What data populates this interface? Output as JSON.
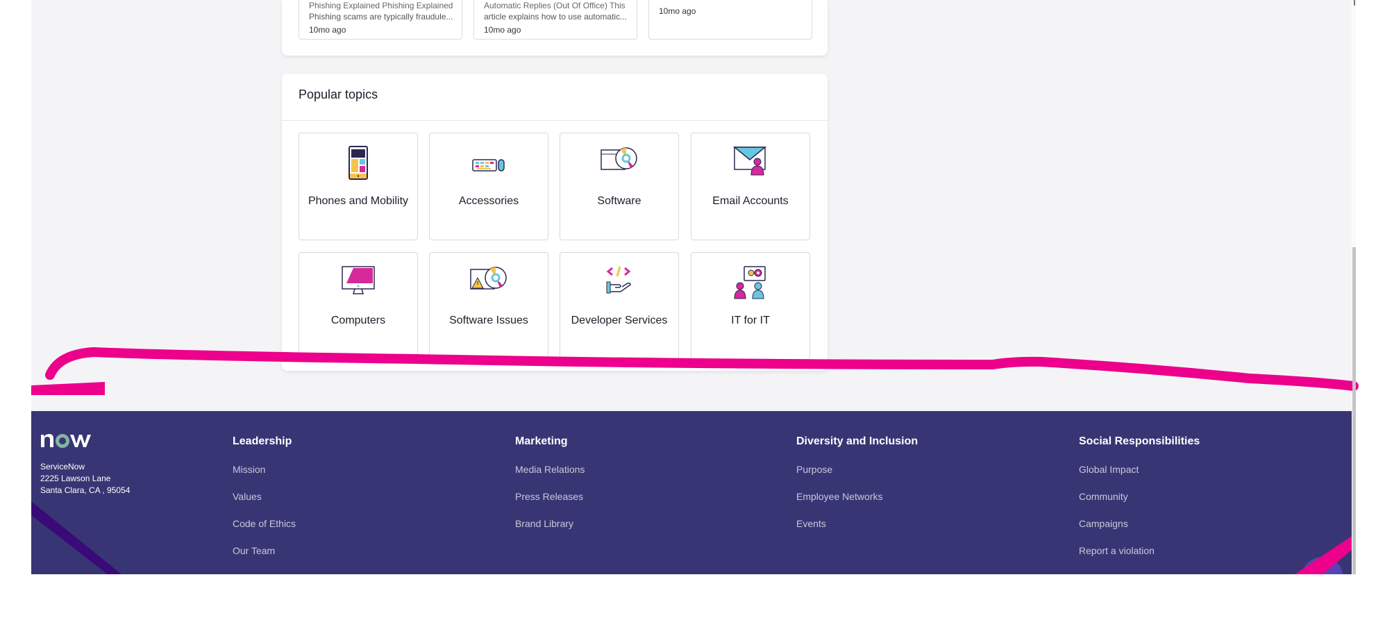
{
  "articles": [
    {
      "cut_title": "Phishing Explained  Phishing Explained",
      "description": "Phishing scams are typically fraudule...",
      "time": "10mo ago"
    },
    {
      "cut_title": "Automatic Replies (Out Of Office) This",
      "description": "article explains how to use automatic...",
      "time": "10mo ago"
    },
    {
      "time": "10mo ago"
    }
  ],
  "popular_topics": {
    "title": "Popular topics",
    "items": [
      {
        "label": "Phones and Mobility",
        "icon": "phone-icon"
      },
      {
        "label": "Accessories",
        "icon": "keyboard-mouse-icon"
      },
      {
        "label": "Software",
        "icon": "software-disc-icon"
      },
      {
        "label": "Email Accounts",
        "icon": "email-user-icon"
      },
      {
        "label": "Computers",
        "icon": "monitor-icon"
      },
      {
        "label": "Software Issues",
        "icon": "software-warning-icon"
      },
      {
        "label": "Developer Services",
        "icon": "code-hand-icon"
      },
      {
        "label": "IT for IT",
        "icon": "people-gears-icon"
      }
    ]
  },
  "footer": {
    "logo_text": "now",
    "company": "ServiceNow",
    "address_line1": "2225 Lawson Lane",
    "address_line2": "Santa Clara, CA , 95054",
    "columns": [
      {
        "heading": "Leadership",
        "links": [
          "Mission",
          "Values",
          "Code of Ethics",
          "Our Team"
        ]
      },
      {
        "heading": "Marketing",
        "links": [
          "Media Relations",
          "Press Releases",
          "Brand Library"
        ]
      },
      {
        "heading": "Diversity and Inclusion",
        "links": [
          "Purpose",
          "Employee Networks",
          "Events"
        ]
      },
      {
        "heading": "Social Responsibilities",
        "links": [
          "Global Impact",
          "Community",
          "Campaigns",
          "Report a violation"
        ]
      }
    ]
  },
  "colors": {
    "footer_bg": "#383574",
    "annotation": "#ec008c",
    "accent_green": "#81b5a1"
  }
}
